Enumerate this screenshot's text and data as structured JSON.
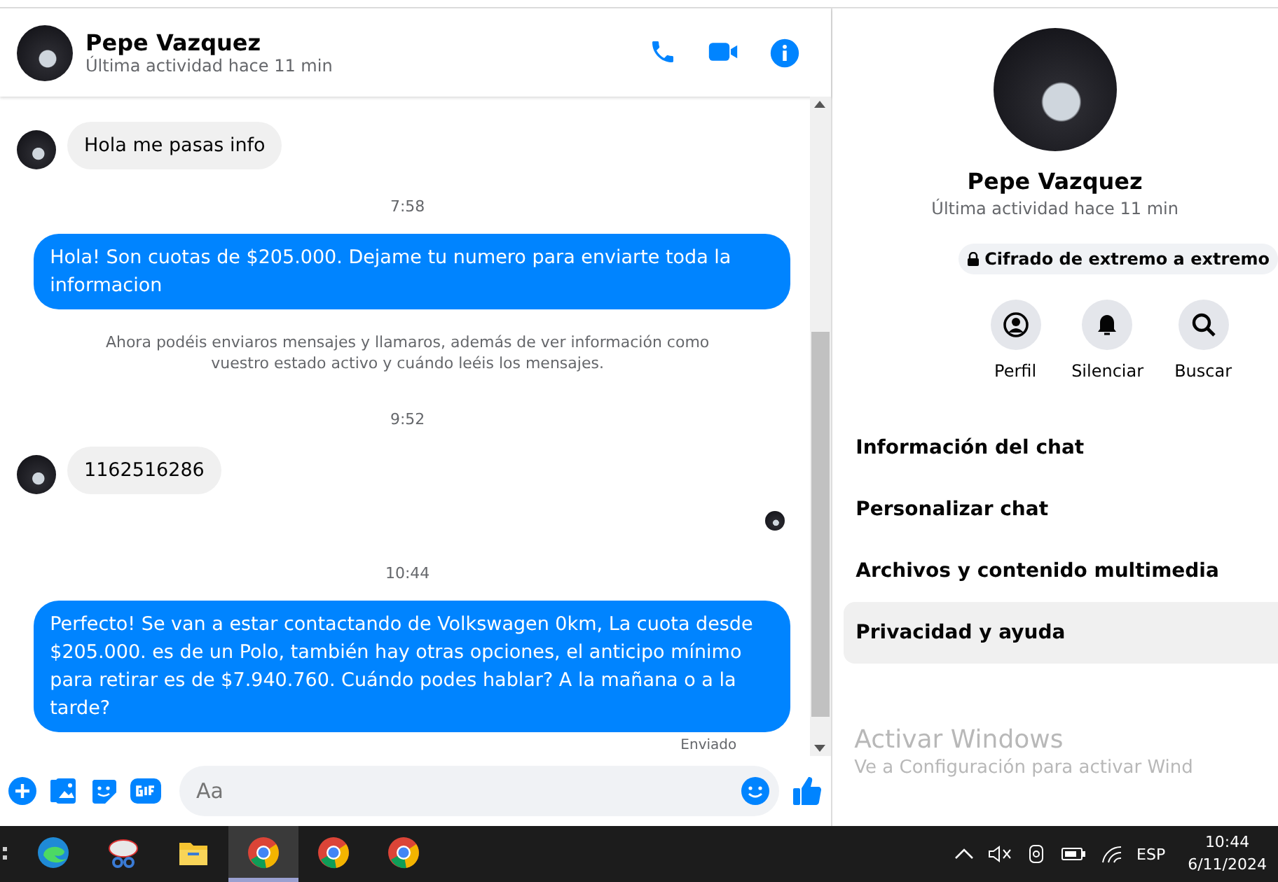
{
  "header": {
    "name": "Pepe Vazquez",
    "status": "Última actividad hace 11 min"
  },
  "messages": [
    {
      "kind": "incoming",
      "text": "Hola me pasas info"
    },
    {
      "kind": "time",
      "text": "7:58"
    },
    {
      "kind": "outgoing",
      "text": "Hola! Son cuotas de $205.000. Dejame tu numero para enviarte toda la informacion"
    },
    {
      "kind": "notice",
      "text": "Ahora podéis enviaros mensajes y llamaros, además de ver información como vuestro estado activo y cuándo leéis los mensajes."
    },
    {
      "kind": "time",
      "text": "9:52"
    },
    {
      "kind": "incoming",
      "text": "1162516286"
    },
    {
      "kind": "seen"
    },
    {
      "kind": "time",
      "text": "10:44"
    },
    {
      "kind": "outgoing",
      "text": "Perfecto!  Se van a estar contactando de Volkswagen 0km, La cuota desde $205.000. es de un Polo, también hay otras opciones, el anticipo mínimo para retirar es de $7.940.760. Cuándo podes hablar? A la mañana o a la tarde?"
    },
    {
      "kind": "status",
      "text": "Enviado"
    }
  ],
  "composer": {
    "placeholder": "Aa"
  },
  "profile": {
    "name": "Pepe Vazquez",
    "status": "Última actividad hace 11 min",
    "encryption": "Cifrado de extremo a extremo",
    "actions": [
      {
        "kind": "profile",
        "label": "Perfil"
      },
      {
        "kind": "mute",
        "label": "Silenciar"
      },
      {
        "kind": "search",
        "label": "Buscar"
      }
    ],
    "menu": [
      {
        "label": "Información del chat",
        "selected": false
      },
      {
        "label": "Personalizar chat",
        "selected": false
      },
      {
        "label": "Archivos y contenido multimedia",
        "selected": false
      },
      {
        "label": "Privacidad y ayuda",
        "selected": true
      }
    ]
  },
  "activation": {
    "title": "Activar Windows",
    "text": "Ve a Configuración para activar Wind"
  },
  "taskbar": {
    "apps": [
      {
        "kind": "edge",
        "selected": false
      },
      {
        "kind": "snip",
        "selected": false
      },
      {
        "kind": "folder",
        "selected": false
      },
      {
        "kind": "chrome",
        "selected": true
      },
      {
        "kind": "chrome",
        "selected": false
      },
      {
        "kind": "chrome",
        "selected": false
      }
    ],
    "language": "ESP",
    "time": "10:44",
    "date": "6/11/2024"
  }
}
